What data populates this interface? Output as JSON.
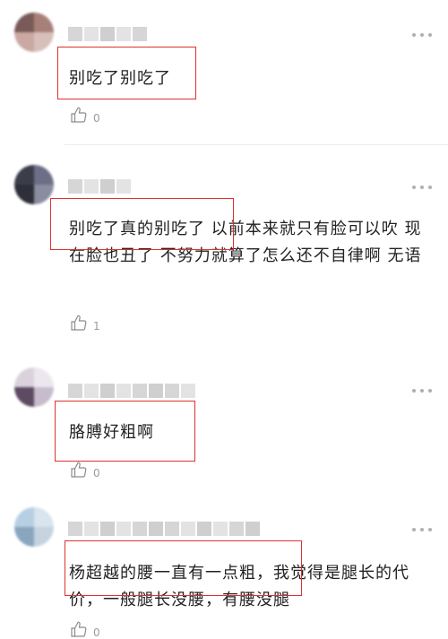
{
  "comments": [
    {
      "text": "别吃了别吃了",
      "likes": "0"
    },
    {
      "text": "别吃了真的别吃了 以前本来就只有脸可以吹 现在脸也丑了 不努力就算了怎么还不自律啊 无语",
      "likes": "1"
    },
    {
      "text": "胳膊好粗啊",
      "likes": "0"
    },
    {
      "text": "杨超越的腰一直有一点粗，我觉得是腿长的代价，一般腿长没腰，有腰没腿",
      "likes": "0"
    }
  ],
  "colors": {
    "highlight_border": "#e0312e",
    "text": "#222222",
    "meta": "#9a9a9a"
  },
  "icons": {
    "like": "thumbs-up-icon",
    "more": "more-options-icon"
  }
}
